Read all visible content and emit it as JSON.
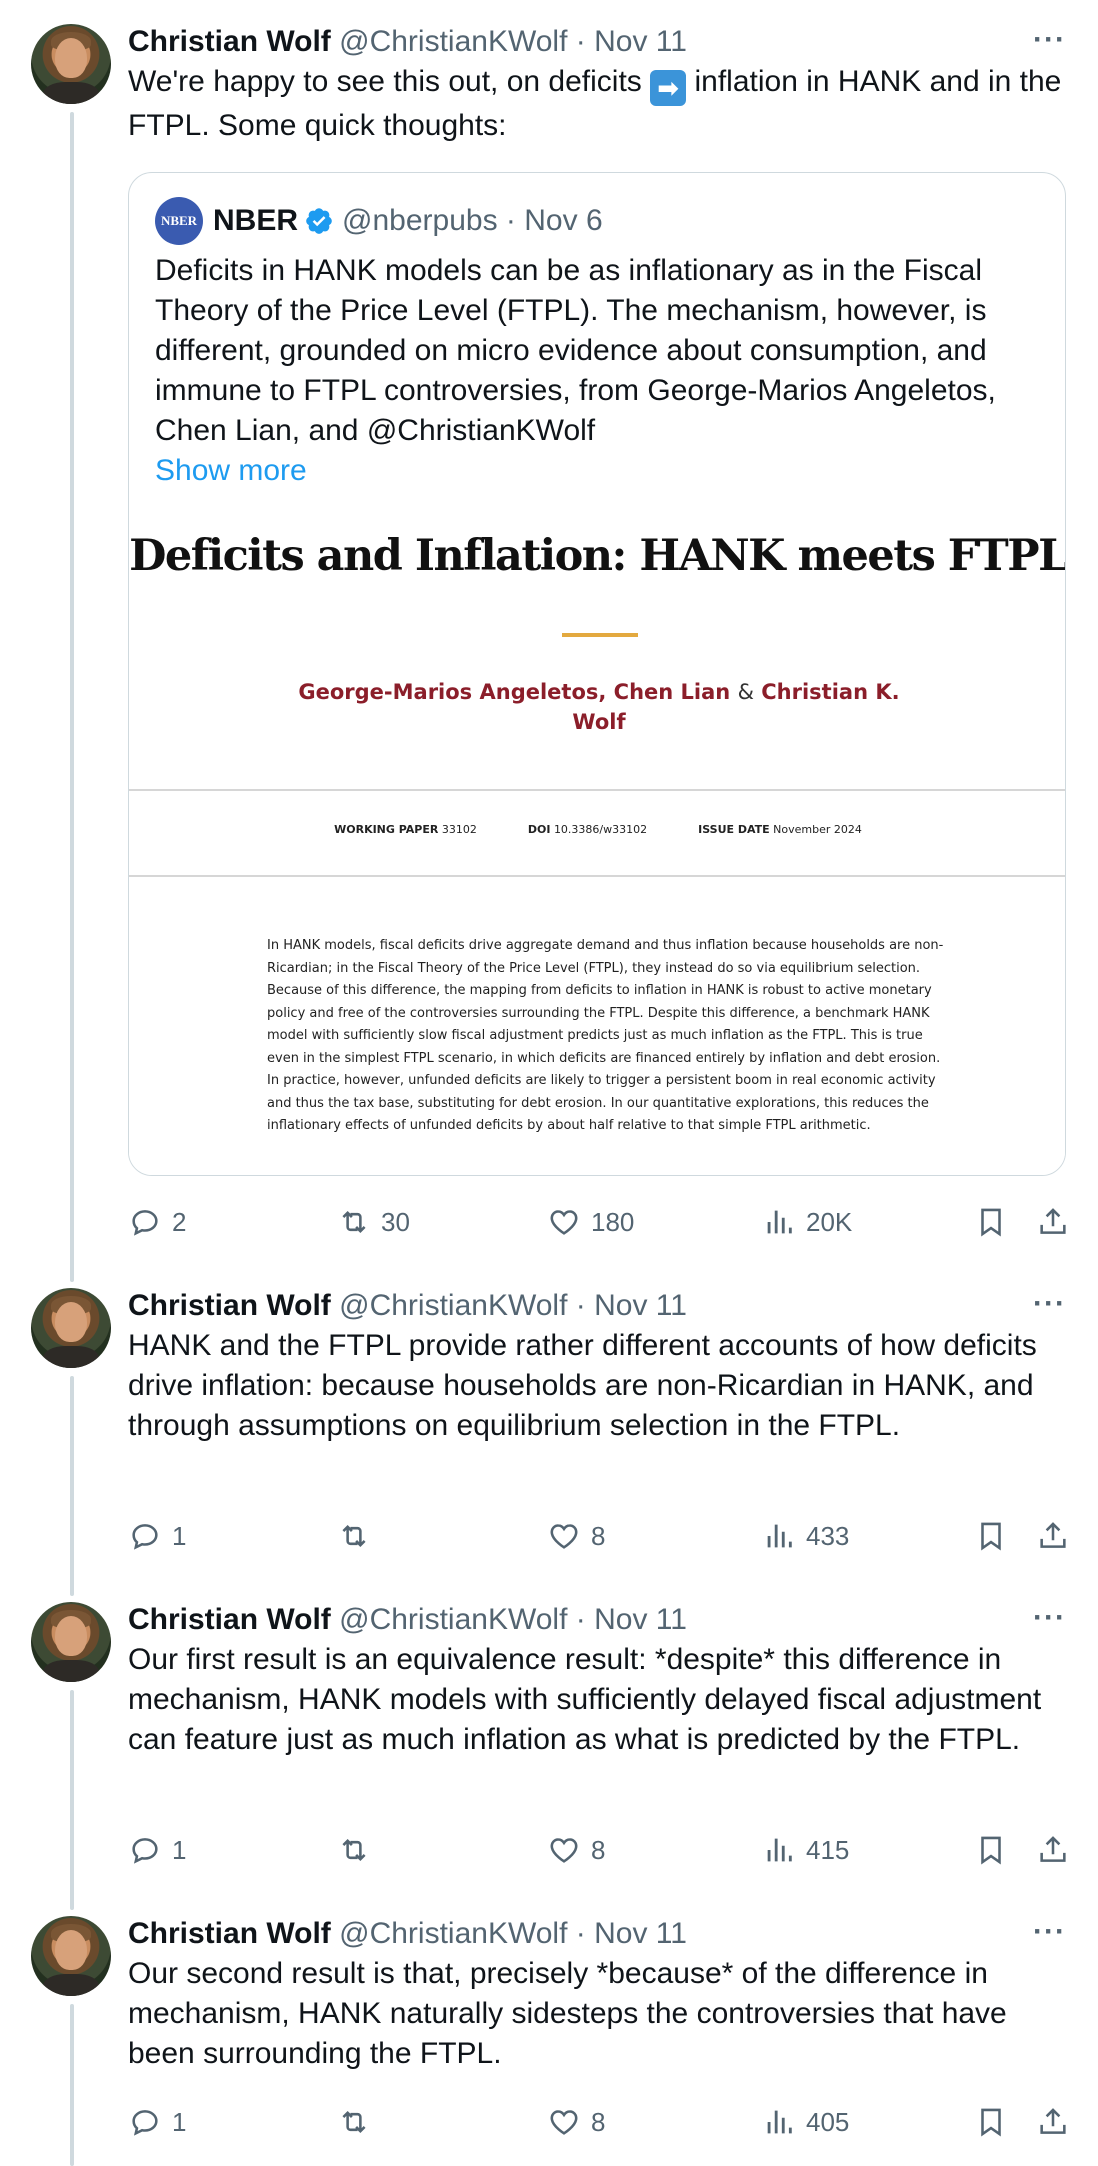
{
  "tweets": [
    {
      "name": "Christian Wolf",
      "handle": "@ChristianKWolf",
      "separator": "·",
      "date": "Nov 11",
      "more": "···",
      "text_before_emoji": "We're happy to see this out, on deficits ",
      "emoji": "➡",
      "text_after_emoji": " inflation in HANK and in the FTPL. Some quick thoughts:",
      "stats": {
        "replies": "2",
        "reposts": "30",
        "likes": "180",
        "views": "20K"
      }
    },
    {
      "name": "Christian Wolf",
      "handle": "@ChristianKWolf",
      "separator": "·",
      "date": "Nov 11",
      "more": "···",
      "text": "HANK and the FTPL provide rather different accounts of how deficits drive inflation: because households are non-Ricardian in HANK, and through assumptions on equilibrium selection in the FTPL.",
      "stats": {
        "replies": "1",
        "reposts": "",
        "likes": "8",
        "views": "433"
      }
    },
    {
      "name": "Christian Wolf",
      "handle": "@ChristianKWolf",
      "separator": "·",
      "date": "Nov 11",
      "more": "···",
      "text": "Our first result is an equivalence result: *despite* this difference in mechanism, HANK models with sufficiently delayed fiscal adjustment can feature just as much inflation as what is predicted by the FTPL.",
      "stats": {
        "replies": "1",
        "reposts": "",
        "likes": "8",
        "views": "415"
      }
    },
    {
      "name": "Christian Wolf",
      "handle": "@ChristianKWolf",
      "separator": "·",
      "date": "Nov 11",
      "more": "···",
      "text": "Our second result is that, precisely *because* of the difference in mechanism, HANK naturally sidesteps the controversies that have been surrounding the FTPL.",
      "stats": {
        "replies": "1",
        "reposts": "",
        "likes": "8",
        "views": "405"
      }
    }
  ],
  "quote": {
    "logo_text": "NBER",
    "name": "NBER",
    "handle": "@nberpubs",
    "separator": "·",
    "date": "Nov 6",
    "text": "Deficits in HANK models can be as inflationary as in the Fiscal Theory of the Price Level (FTPL). The mechanism, however, is different, grounded on micro evidence about consumption, and immune to FTPL controversies, from George-Marios Angeletos, Chen Lian, and @ChristianKWolf",
    "show_more": "Show more",
    "paper": {
      "title": "Deficits and Inflation: HANK meets FTPL",
      "author1": "George-Marios Angeletos,",
      "author2": "Chen Lian",
      "amp": "&",
      "author3": "Christian K. Wolf",
      "wp_label": "WORKING PAPER",
      "wp_value": "33102",
      "doi_label": "DOI",
      "doi_value": "10.3386/w33102",
      "issue_label": "ISSUE DATE",
      "issue_value": "November 2024",
      "abstract": "In HANK models, fiscal deficits drive aggregate demand and thus inflation because households are non-Ricardian; in the Fiscal Theory of the Price Level (FTPL), they instead do so via equilibrium selection. Because of this difference, the mapping from deficits to inflation in HANK is robust to active monetary policy and free of the controversies surrounding the FTPL. Despite this difference, a benchmark HANK model with sufficiently slow fiscal adjustment predicts just as much inflation as the FTPL. This is true even in the simplest FTPL scenario, in which deficits are financed entirely by inflation and debt erosion. In practice, however, unfunded deficits are likely to trigger a persistent boom in real economic activity and thus the tax base, substituting for debt erosion. In our quantitative explorations, this reduces the inflationary effects of unfunded deficits by about half relative to that simple FTPL arithmetic."
    }
  },
  "colors": {
    "text": "#0f1419",
    "secondary": "#536471",
    "link": "#1d9bf0",
    "border": "#cfd9de",
    "author_red": "#8b1e2a",
    "title_rule": "#e3a93f"
  },
  "icons": [
    "reply-icon",
    "repost-icon",
    "like-icon",
    "views-icon",
    "bookmark-icon",
    "share-icon",
    "verified-badge-icon",
    "more-icon"
  ]
}
